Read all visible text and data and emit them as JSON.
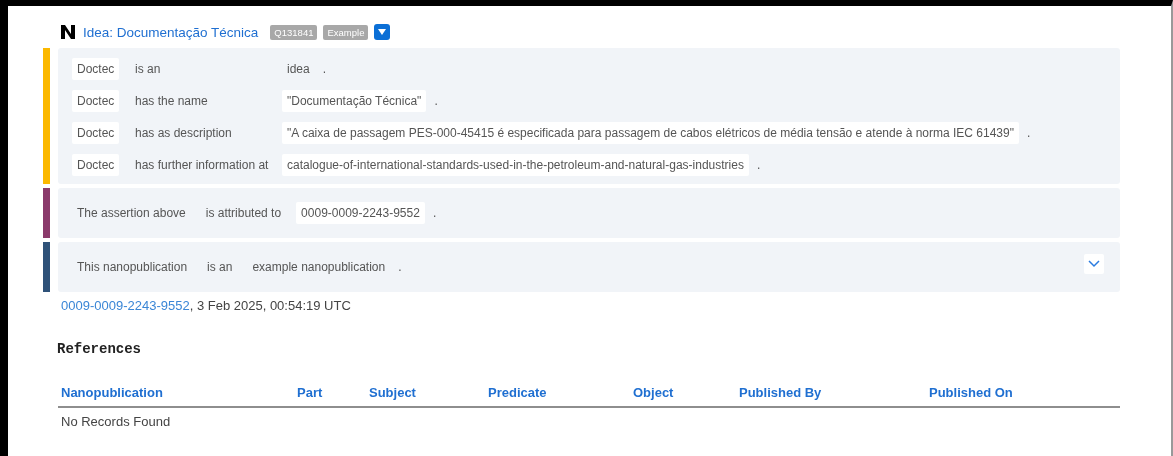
{
  "header": {
    "title": "Idea: Documentação Técnica",
    "badges": [
      "Q131841",
      "Example"
    ]
  },
  "sections": [
    {
      "kind": "assertion",
      "color": "#fbb800",
      "statements": [
        {
          "subject": "Doctec",
          "subject_chip": true,
          "predicate": "is an",
          "object": "idea",
          "object_chip": false,
          "end": "."
        },
        {
          "subject": "Doctec",
          "subject_chip": true,
          "predicate": "has the name",
          "object": "\"Documentação Técnica\"",
          "object_chip": true,
          "end": "."
        },
        {
          "subject": "Doctec",
          "subject_chip": true,
          "predicate": "has as description",
          "object": "\"A caixa de passagem PES-000-45415 é especificada para passagem de cabos elétricos de média tensão e atende à norma IEC 61439\"",
          "object_chip": true,
          "end": "."
        },
        {
          "subject": "Doctec",
          "subject_chip": true,
          "predicate": "has further information at",
          "object": "catalogue-of-international-standards-used-in-the-petroleum-and-natural-gas-industries",
          "object_chip": true,
          "end": "."
        }
      ]
    },
    {
      "kind": "provenance",
      "color": "#8b3a6b",
      "statements": [
        {
          "subject": "The assertion above",
          "subject_chip": false,
          "predicate": "is attributed to",
          "object": "0009-0009-2243-9552",
          "object_chip": true,
          "end": "."
        }
      ]
    },
    {
      "kind": "pubinfo",
      "color": "#2f5279",
      "expanded": false,
      "statements": [
        {
          "subject": "This nanopublication",
          "subject_chip": false,
          "predicate": "is an",
          "object": "example nanopublication",
          "object_chip": false,
          "end": "."
        }
      ]
    }
  ],
  "footer": {
    "author": "0009-0009-2243-9552",
    "date_text": ", 3 Feb 2025, 00:54:19 UTC"
  },
  "references": {
    "title": "References",
    "columns": [
      "Nanopublication",
      "Part",
      "Subject",
      "Predicate",
      "Object",
      "Published By",
      "Published On"
    ],
    "empty_text": "No Records Found"
  }
}
